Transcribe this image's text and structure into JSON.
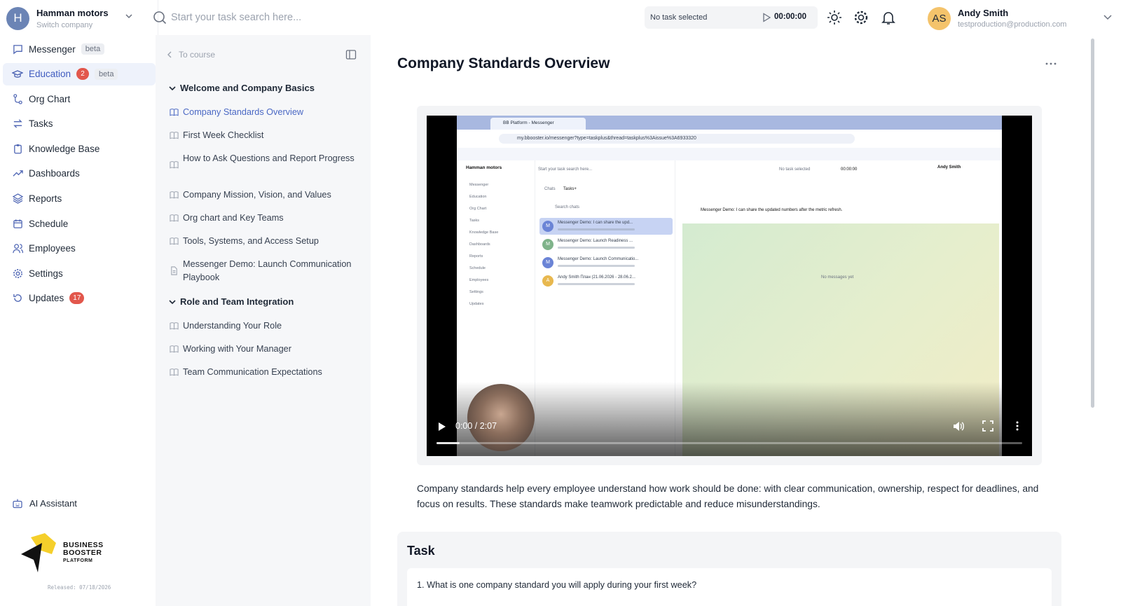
{
  "company": {
    "initial": "H",
    "name": "Hamman motors",
    "switch_label": "Switch company"
  },
  "search": {
    "placeholder": "Start your task search here..."
  },
  "timer": {
    "status": "No task selected",
    "time": "00:00:00"
  },
  "user": {
    "initials": "AS",
    "name": "Andy Smith",
    "email": "testproduction@production.com"
  },
  "sidebar": {
    "items": [
      {
        "label": "Messenger",
        "icon": "message-icon",
        "badge_beta": "beta"
      },
      {
        "label": "Education",
        "icon": "graduation-cap-icon",
        "badge_count": "2",
        "badge_beta": "beta",
        "active": true
      },
      {
        "label": "Org Chart",
        "icon": "org-chart-icon"
      },
      {
        "label": "Tasks",
        "icon": "tasks-icon"
      },
      {
        "label": "Knowledge Base",
        "icon": "clipboard-icon"
      },
      {
        "label": "Dashboards",
        "icon": "trend-icon"
      },
      {
        "label": "Reports",
        "icon": "layers-icon"
      },
      {
        "label": "Schedule",
        "icon": "calendar-icon"
      },
      {
        "label": "Employees",
        "icon": "users-icon"
      },
      {
        "label": "Settings",
        "icon": "gear-icon"
      },
      {
        "label": "Updates",
        "icon": "refresh-icon",
        "badge_count": "17"
      }
    ],
    "ai_assistant": "AI Assistant",
    "logo": {
      "line1": "BUSINESS",
      "line2": "BOOSTER",
      "line3": "PLATFORM"
    },
    "released": "Released: 07/18/2026"
  },
  "course": {
    "back_label": "To course",
    "sections": [
      {
        "title": "Welcome and Company Basics",
        "lessons": [
          {
            "title": "Company Standards Overview",
            "active": true
          },
          {
            "title": "First Week Checklist"
          },
          {
            "title": "How to Ask Questions and Report Progress"
          },
          {
            "title": "Company Mission, Vision, and Values"
          },
          {
            "title": "Org chart and Key Teams"
          },
          {
            "title": "Tools, Systems, and Access Setup"
          },
          {
            "title": "Messenger Demo: Launch Communication Playbook",
            "icon": "document-icon"
          }
        ]
      },
      {
        "title": "Role and Team Integration",
        "lessons": [
          {
            "title": "Understanding Your Role"
          },
          {
            "title": "Working with Your Manager"
          },
          {
            "title": "Team Communication Expectations"
          }
        ]
      }
    ]
  },
  "main": {
    "title": "Company Standards Overview",
    "video": {
      "time": "0:00 / 2:07",
      "progress": 0.04,
      "screen": {
        "tab_title": "BB Platform - Messenger",
        "url": "my.bbooster.io/messenger?type=taskplus&thread=taskplus%3Aissue%3A6933320",
        "company": "Hamman motors",
        "search_placeholder": "Start your task search here...",
        "timer_status": "No task selected",
        "timer_time": "00:00:00",
        "user_name": "Andy Smith",
        "tabs": [
          "Chats",
          "Tasks+"
        ],
        "search_chats": "Search chats",
        "header_message": "Messenger Demo: I can share the updated numbers after the metric refresh.",
        "empty_state": "No messages yet",
        "chats": [
          {
            "initial": "M",
            "title": "Messenger Demo: I can share the upd...",
            "color": "#6b84d6"
          },
          {
            "initial": "M",
            "title": "Messenger Demo: Launch Readiness ...",
            "color": "#7fb38a"
          },
          {
            "initial": "M",
            "title": "Messenger Demo: Launch Communicatio...",
            "color": "#6b84d6"
          },
          {
            "initial": "A",
            "title": "Andy Smith План (21.06.2026 - 28.06.2...",
            "color": "#e8b84f"
          }
        ],
        "nav": [
          "Messenger",
          "Education",
          "Org Chart",
          "Tasks",
          "Knowledge Base",
          "Dashboards",
          "Reports",
          "Schedule",
          "Employees",
          "Settings",
          "Updates"
        ]
      }
    },
    "description": "Company standards help every employee understand how work should be done: with clear communication, ownership, respect for deadlines, and focus on results. These standards make teamwork predictable and reduce misunderstandings.",
    "task": {
      "title": "Task",
      "question": "1. What is one company standard you will apply during your first week?"
    }
  },
  "colors": {
    "accent": "#4a68c4",
    "badge_red": "#e2574c",
    "active_bg": "#eef2fb",
    "panel_bg": "#f6f7f9"
  }
}
